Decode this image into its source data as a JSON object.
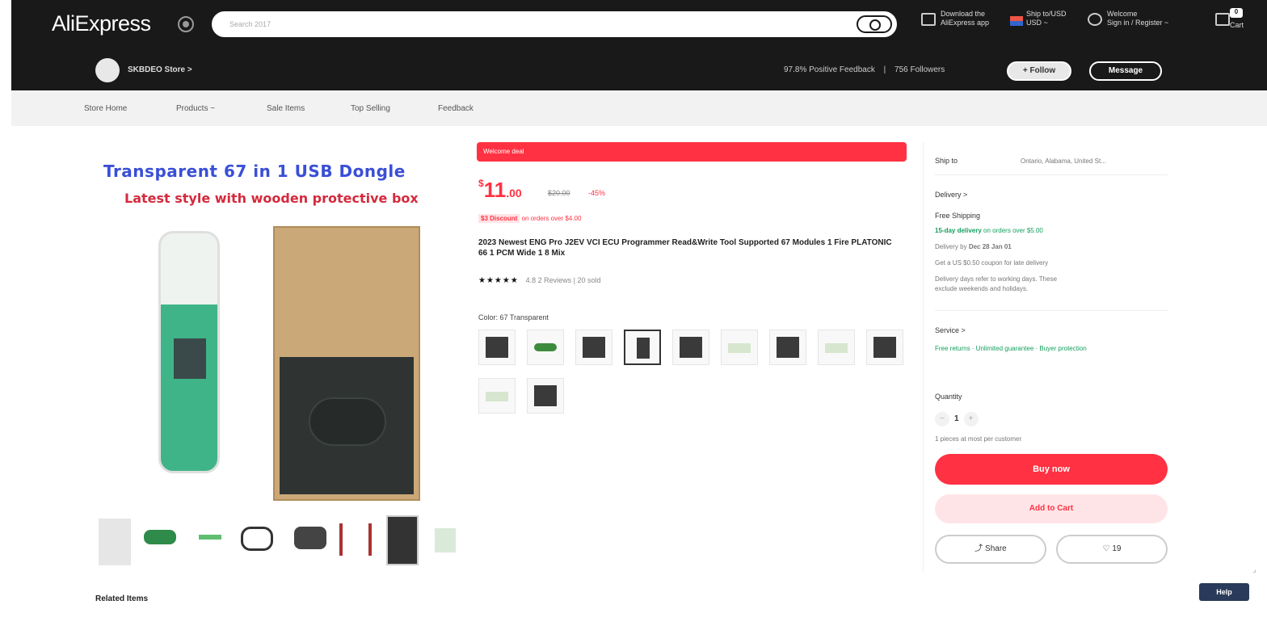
{
  "header": {
    "logo": "AliExpress",
    "search_placeholder": "Search 2017",
    "download_line1": "Download the",
    "download_line2": "AliExpress app",
    "ship_line1": "Ship to/USD",
    "ship_line2": "USD ~",
    "welcome_line1": "Welcome",
    "welcome_line2": "Sign in / Register ~",
    "cart_count": "0",
    "cart_label": "Cart"
  },
  "store": {
    "name": "SKBDEO Store",
    "chevron": ">",
    "feedback": "97.8% Positive Feedback",
    "separator": "|",
    "followers": "756 Followers",
    "follow_label": "+ Follow",
    "message_label": "Message"
  },
  "subnav": {
    "items": [
      "Store Home",
      "Products ~",
      "Sale Items",
      "Top Selling",
      "Feedback"
    ]
  },
  "gallery": {
    "title_line1": "Transparent 67 in 1 USB Dongle",
    "title_line2": "Latest style with wooden protective box"
  },
  "product": {
    "deal_label": "Welcome deal",
    "currency": "$",
    "price_int": "11",
    "price_dec": ".00",
    "old_price": "$20.00",
    "discount": "-45%",
    "promo_tag": "$3 Discount",
    "promo_text": "on orders over $4.00",
    "title": "2023 Newest ENG Pro J2EV VCI ECU Programmer Read&Write Tool Supported 67 Modules 1 Fire PLATONIC 66 1 PCM Wide 1 8 Mix",
    "stars": "★★★★★",
    "rating_meta": "4.8  2 Reviews  |  20 sold",
    "color_label": "Color: 67 Transparent"
  },
  "sidebar": {
    "ship_to_label": "Ship to",
    "ship_to_value": "Ontario, Alabama, United St...",
    "delivery_label": "Delivery >",
    "free_shipping": "Free Shipping",
    "fast_delivery": "15-day delivery",
    "fast_delivery_note": "on orders over $5.00",
    "delivery_by_prefix": "Delivery by",
    "delivery_by_date": "Dec 28 Jan 01",
    "coupon_text": "Get a US $0.50 coupon for late delivery",
    "note1": "Delivery days refer to working days. These",
    "note2": "exclude weekends and holidays.",
    "service_label": "Service >",
    "service_text": "Free returns · Unlimited guarantee · Buyer protection",
    "quantity_label": "Quantity",
    "qty_value": "1",
    "qty_limit": "1 pieces at most per customer",
    "buy_now": "Buy now",
    "add_to_cart": "Add to Cart",
    "share_label": "Share",
    "like_label": "19"
  },
  "footer": {
    "related": "Related Items",
    "float_btn": "Help"
  },
  "colors": {
    "brand_red": "#ff3142",
    "header_bg": "#191919",
    "green_text": "#13a05d"
  }
}
